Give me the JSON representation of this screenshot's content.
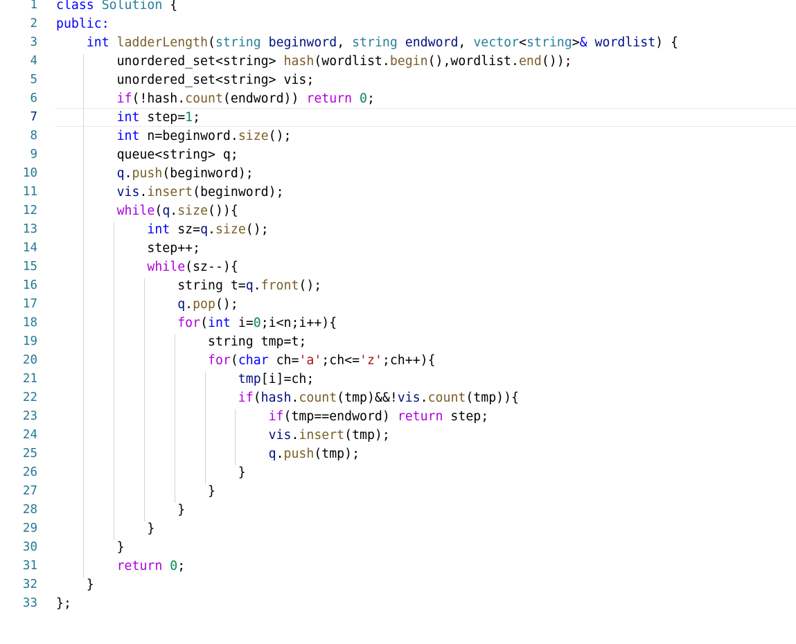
{
  "editor": {
    "current_line": 7,
    "colors": {
      "keyword": "#0000ff",
      "control": "#af00db",
      "function": "#795e26",
      "type": "#267f99",
      "variable": "#001080",
      "number": "#098658",
      "string": "#a31515",
      "line_number": "#237893",
      "active_line_number": "#0b216f",
      "indent_guide": "#d3d3d3"
    },
    "lines": [
      {
        "num": "1",
        "tokens": [
          {
            "t": "class",
            "c": "k"
          },
          {
            "t": " ",
            "c": "p"
          },
          {
            "t": "Solution",
            "c": "t"
          },
          {
            "t": " {",
            "c": "p"
          }
        ]
      },
      {
        "num": "2",
        "tokens": [
          {
            "t": "public",
            "c": "k"
          },
          {
            "t": ":",
            "c": "k"
          }
        ]
      },
      {
        "num": "3",
        "tokens": [
          {
            "t": "    ",
            "c": "p"
          },
          {
            "t": "int",
            "c": "k"
          },
          {
            "t": " ",
            "c": "p"
          },
          {
            "t": "ladderLength",
            "c": "f"
          },
          {
            "t": "(",
            "c": "p"
          },
          {
            "t": "string",
            "c": "t"
          },
          {
            "t": " ",
            "c": "p"
          },
          {
            "t": "beginword",
            "c": "v"
          },
          {
            "t": ", ",
            "c": "p"
          },
          {
            "t": "string",
            "c": "t"
          },
          {
            "t": " ",
            "c": "p"
          },
          {
            "t": "endword",
            "c": "v"
          },
          {
            "t": ", ",
            "c": "p"
          },
          {
            "t": "vector",
            "c": "t"
          },
          {
            "t": "<",
            "c": "p"
          },
          {
            "t": "string",
            "c": "t"
          },
          {
            "t": ">",
            "c": "p"
          },
          {
            "t": "&",
            "c": "k"
          },
          {
            "t": " ",
            "c": "p"
          },
          {
            "t": "wordlist",
            "c": "v"
          },
          {
            "t": ") {",
            "c": "p"
          }
        ]
      },
      {
        "num": "4",
        "tokens": [
          {
            "t": "        unordered_set<string> ",
            "c": "p"
          },
          {
            "t": "hash",
            "c": "f"
          },
          {
            "t": "(wordlist.",
            "c": "p"
          },
          {
            "t": "begin",
            "c": "f"
          },
          {
            "t": "(),wordlist.",
            "c": "p"
          },
          {
            "t": "end",
            "c": "f"
          },
          {
            "t": "());",
            "c": "p"
          }
        ]
      },
      {
        "num": "5",
        "tokens": [
          {
            "t": "        unordered_set<string> vis;",
            "c": "p"
          }
        ]
      },
      {
        "num": "6",
        "tokens": [
          {
            "t": "        ",
            "c": "p"
          },
          {
            "t": "if",
            "c": "c"
          },
          {
            "t": "(!hash.",
            "c": "p"
          },
          {
            "t": "count",
            "c": "f"
          },
          {
            "t": "(endword)) ",
            "c": "p"
          },
          {
            "t": "return",
            "c": "c"
          },
          {
            "t": " ",
            "c": "p"
          },
          {
            "t": "0",
            "c": "n"
          },
          {
            "t": ";",
            "c": "p"
          }
        ]
      },
      {
        "num": "7",
        "tokens": [
          {
            "t": "        ",
            "c": "p"
          },
          {
            "t": "int",
            "c": "k"
          },
          {
            "t": " step=",
            "c": "p"
          },
          {
            "t": "1",
            "c": "n"
          },
          {
            "t": ";",
            "c": "p"
          }
        ]
      },
      {
        "num": "8",
        "tokens": [
          {
            "t": "        ",
            "c": "p"
          },
          {
            "t": "int",
            "c": "k"
          },
          {
            "t": " n=beginword.",
            "c": "p"
          },
          {
            "t": "size",
            "c": "f"
          },
          {
            "t": "();",
            "c": "p"
          }
        ]
      },
      {
        "num": "9",
        "tokens": [
          {
            "t": "        queue<string> q;",
            "c": "p"
          }
        ]
      },
      {
        "num": "10",
        "tokens": [
          {
            "t": "        ",
            "c": "p"
          },
          {
            "t": "q",
            "c": "v"
          },
          {
            "t": ".",
            "c": "p"
          },
          {
            "t": "push",
            "c": "f"
          },
          {
            "t": "(beginword);",
            "c": "p"
          }
        ]
      },
      {
        "num": "11",
        "tokens": [
          {
            "t": "        ",
            "c": "p"
          },
          {
            "t": "vis",
            "c": "v"
          },
          {
            "t": ".",
            "c": "p"
          },
          {
            "t": "insert",
            "c": "f"
          },
          {
            "t": "(beginword);",
            "c": "p"
          }
        ]
      },
      {
        "num": "12",
        "tokens": [
          {
            "t": "        ",
            "c": "p"
          },
          {
            "t": "while",
            "c": "c"
          },
          {
            "t": "(",
            "c": "p"
          },
          {
            "t": "q",
            "c": "v"
          },
          {
            "t": ".",
            "c": "p"
          },
          {
            "t": "size",
            "c": "f"
          },
          {
            "t": "()){",
            "c": "p"
          }
        ]
      },
      {
        "num": "13",
        "tokens": [
          {
            "t": "            ",
            "c": "p"
          },
          {
            "t": "int",
            "c": "k"
          },
          {
            "t": " sz=",
            "c": "p"
          },
          {
            "t": "q",
            "c": "v"
          },
          {
            "t": ".",
            "c": "p"
          },
          {
            "t": "size",
            "c": "f"
          },
          {
            "t": "();",
            "c": "p"
          }
        ]
      },
      {
        "num": "14",
        "tokens": [
          {
            "t": "            step++;",
            "c": "p"
          }
        ]
      },
      {
        "num": "15",
        "tokens": [
          {
            "t": "            ",
            "c": "p"
          },
          {
            "t": "while",
            "c": "c"
          },
          {
            "t": "(sz--){",
            "c": "p"
          }
        ]
      },
      {
        "num": "16",
        "tokens": [
          {
            "t": "                string t=",
            "c": "p"
          },
          {
            "t": "q",
            "c": "v"
          },
          {
            "t": ".",
            "c": "p"
          },
          {
            "t": "front",
            "c": "f"
          },
          {
            "t": "();",
            "c": "p"
          }
        ]
      },
      {
        "num": "17",
        "tokens": [
          {
            "t": "                ",
            "c": "p"
          },
          {
            "t": "q",
            "c": "v"
          },
          {
            "t": ".",
            "c": "p"
          },
          {
            "t": "pop",
            "c": "f"
          },
          {
            "t": "();",
            "c": "p"
          }
        ]
      },
      {
        "num": "18",
        "tokens": [
          {
            "t": "                ",
            "c": "p"
          },
          {
            "t": "for",
            "c": "c"
          },
          {
            "t": "(",
            "c": "p"
          },
          {
            "t": "int",
            "c": "k"
          },
          {
            "t": " i=",
            "c": "p"
          },
          {
            "t": "0",
            "c": "n"
          },
          {
            "t": ";i<n;i++){",
            "c": "p"
          }
        ]
      },
      {
        "num": "19",
        "tokens": [
          {
            "t": "                    string tmp=t;",
            "c": "p"
          }
        ]
      },
      {
        "num": "20",
        "tokens": [
          {
            "t": "                    ",
            "c": "p"
          },
          {
            "t": "for",
            "c": "c"
          },
          {
            "t": "(",
            "c": "p"
          },
          {
            "t": "char",
            "c": "k"
          },
          {
            "t": " ch=",
            "c": "p"
          },
          {
            "t": "'a'",
            "c": "s"
          },
          {
            "t": ";ch<=",
            "c": "p"
          },
          {
            "t": "'z'",
            "c": "s"
          },
          {
            "t": ";ch++){",
            "c": "p"
          }
        ]
      },
      {
        "num": "21",
        "tokens": [
          {
            "t": "                        ",
            "c": "p"
          },
          {
            "t": "tmp",
            "c": "v"
          },
          {
            "t": "[i]=ch;",
            "c": "p"
          }
        ]
      },
      {
        "num": "22",
        "tokens": [
          {
            "t": "                        ",
            "c": "p"
          },
          {
            "t": "if",
            "c": "c"
          },
          {
            "t": "(",
            "c": "p"
          },
          {
            "t": "hash",
            "c": "v"
          },
          {
            "t": ".",
            "c": "p"
          },
          {
            "t": "count",
            "c": "f"
          },
          {
            "t": "(tmp)&&!",
            "c": "p"
          },
          {
            "t": "vis",
            "c": "v"
          },
          {
            "t": ".",
            "c": "p"
          },
          {
            "t": "count",
            "c": "f"
          },
          {
            "t": "(tmp)){",
            "c": "p"
          }
        ]
      },
      {
        "num": "23",
        "tokens": [
          {
            "t": "                            ",
            "c": "p"
          },
          {
            "t": "if",
            "c": "c"
          },
          {
            "t": "(tmp==endword) ",
            "c": "p"
          },
          {
            "t": "return",
            "c": "c"
          },
          {
            "t": " step;",
            "c": "p"
          }
        ]
      },
      {
        "num": "24",
        "tokens": [
          {
            "t": "                            ",
            "c": "p"
          },
          {
            "t": "vis",
            "c": "v"
          },
          {
            "t": ".",
            "c": "p"
          },
          {
            "t": "insert",
            "c": "f"
          },
          {
            "t": "(tmp);",
            "c": "p"
          }
        ]
      },
      {
        "num": "25",
        "tokens": [
          {
            "t": "                            ",
            "c": "p"
          },
          {
            "t": "q",
            "c": "v"
          },
          {
            "t": ".",
            "c": "p"
          },
          {
            "t": "push",
            "c": "f"
          },
          {
            "t": "(tmp);",
            "c": "p"
          }
        ]
      },
      {
        "num": "26",
        "tokens": [
          {
            "t": "                        }",
            "c": "p"
          }
        ]
      },
      {
        "num": "27",
        "tokens": [
          {
            "t": "                    }",
            "c": "p"
          }
        ]
      },
      {
        "num": "28",
        "tokens": [
          {
            "t": "                }",
            "c": "p"
          }
        ]
      },
      {
        "num": "29",
        "tokens": [
          {
            "t": "            }",
            "c": "p"
          }
        ]
      },
      {
        "num": "30",
        "tokens": [
          {
            "t": "        }",
            "c": "p"
          }
        ]
      },
      {
        "num": "31",
        "tokens": [
          {
            "t": "        ",
            "c": "p"
          },
          {
            "t": "return",
            "c": "c"
          },
          {
            "t": " ",
            "c": "p"
          },
          {
            "t": "0",
            "c": "n"
          },
          {
            "t": ";",
            "c": "p"
          }
        ]
      },
      {
        "num": "32",
        "tokens": [
          {
            "t": "    }",
            "c": "p"
          }
        ]
      },
      {
        "num": "33",
        "tokens": [
          {
            "t": "};",
            "c": "p"
          }
        ]
      }
    ]
  }
}
